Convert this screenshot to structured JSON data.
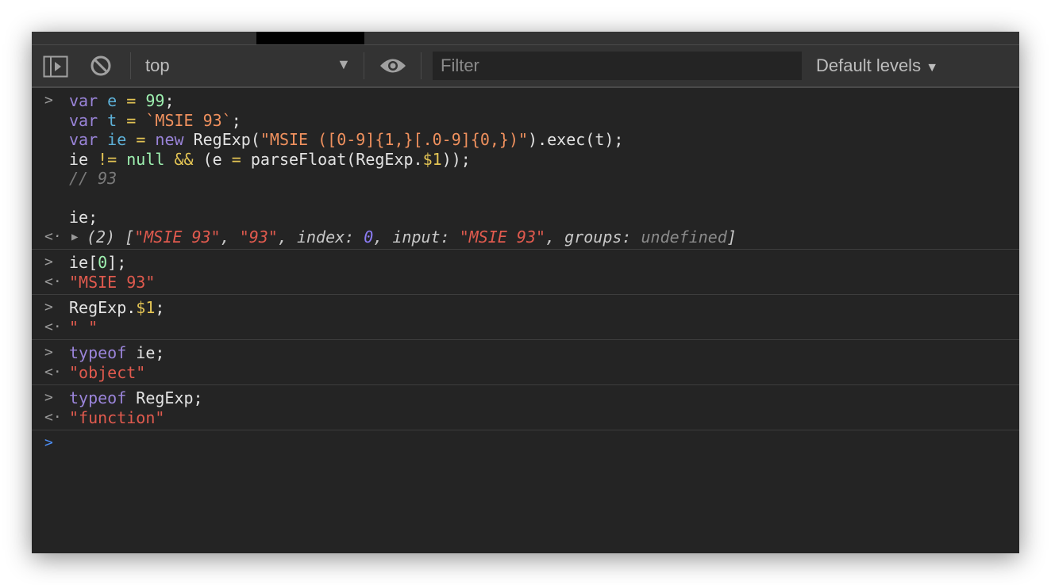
{
  "toolbar": {
    "context": "top",
    "filter_placeholder": "Filter",
    "levels": "Default levels"
  },
  "console": {
    "e1": {
      "l1": [
        "var",
        "e",
        "=",
        "99",
        ";"
      ],
      "l2": [
        "var",
        "t",
        "=",
        "`MSIE 93`",
        ";"
      ],
      "l3": [
        "var",
        "ie",
        "=",
        "new",
        "RegExp(",
        "\"MSIE ([0-9]{1,}[.0-9]{0,})\"",
        ").exec(t);"
      ],
      "l4": [
        "ie ",
        "!=",
        "null",
        "&&",
        "(e ",
        "=",
        "parseFloat(RegExp.",
        "$1",
        "));"
      ],
      "l5": "// 93",
      "l7": "ie;",
      "result": {
        "count": "(2) [",
        "a": "\"MSIE 93\"",
        "b": "\"93\"",
        "index_label": "index: ",
        "index": "0",
        "input_label": "input: ",
        "input": "\"MSIE 93\"",
        "groups_label": "groups: ",
        "groups": "undefined",
        "close": "]"
      }
    },
    "e2": {
      "pre": "ie[",
      "num": "0",
      "post": "];",
      "result": "\"MSIE 93\""
    },
    "e3": {
      "pre": "RegExp.",
      "dol": "$1",
      "post": ";",
      "result": "\" \""
    },
    "e4": {
      "kw": "typeof",
      "rest": " ie;",
      "result": "\"object\""
    },
    "e5": {
      "kw": "typeof",
      "rest": " RegExp;",
      "result": "\"function\""
    }
  },
  "colors": {
    "keyword": "#9a84d9",
    "string_output": "#e05a4e",
    "prompt_active": "#4d8ff7"
  }
}
